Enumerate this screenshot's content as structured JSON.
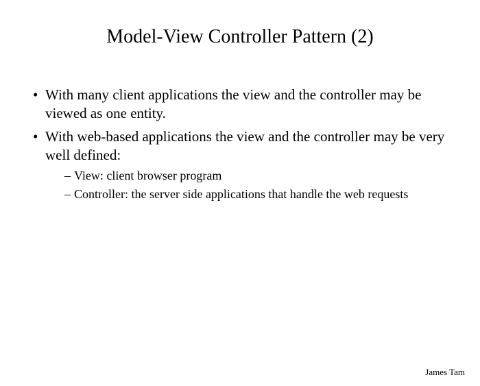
{
  "title": "Model-View Controller Pattern (2)",
  "bullets": [
    {
      "text": "With many client applications the view and the controller may be viewed as one entity."
    },
    {
      "text": "With web-based applications the view and the controller may be very well defined:",
      "children": [
        "View: client browser program",
        "Controller: the server side applications that handle the web requests"
      ]
    }
  ],
  "author": "James Tam"
}
